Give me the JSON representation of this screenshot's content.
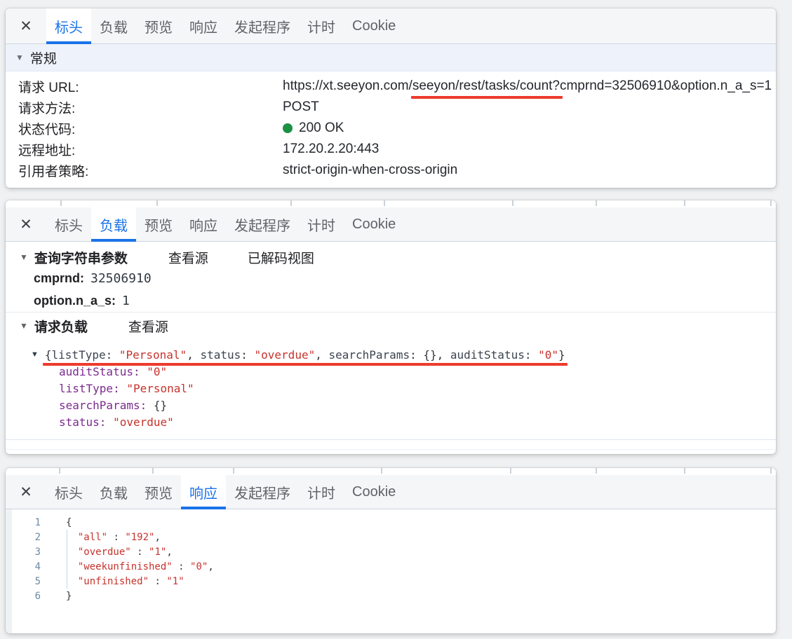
{
  "icons": {
    "close": "✕",
    "section_collapse": "▼",
    "tree_collapse": "▼"
  },
  "colors": {
    "accent_blue": "#1a73e8",
    "status_green": "#1c9144",
    "annotation_red": "#ee3a2c",
    "json_key_purple": "#7c2a8e",
    "json_string_red": "#c7322c"
  },
  "tab_labels": [
    "标头",
    "负载",
    "预览",
    "响应",
    "发起程序",
    "计时",
    "Cookie"
  ],
  "headers_panel": {
    "active_tab": "标头",
    "general_section_label": "常规",
    "rows": {
      "url": {
        "label": "请求 URL:",
        "prefix": "https://xt.seeyon.com/",
        "underlined": "seeyon/rest/tasks/count?",
        "suffix": "cmprnd=32506910&option.n_a_s=1"
      },
      "method": {
        "label": "请求方法:",
        "value": "POST"
      },
      "status": {
        "label": "状态代码:",
        "value": "200 OK"
      },
      "remote": {
        "label": "远程地址:",
        "value": "172.20.2.20:443"
      },
      "referrer": {
        "label": "引用者策略:",
        "value": "strict-origin-when-cross-origin"
      }
    }
  },
  "payload_panel": {
    "active_tab": "负载",
    "query_section": {
      "title": "查询字符串参数",
      "view_source_label": "查看源",
      "decoded_view_label": "已解码视图",
      "params": [
        {
          "name": "cmprnd:",
          "value": "32506910"
        },
        {
          "name": "option.n_a_s:",
          "value": "1"
        }
      ]
    },
    "payload_section": {
      "title": "请求负载",
      "view_source_label": "查看源",
      "preview_tokens": [
        {
          "t": "{",
          "c": "pun"
        },
        {
          "t": "listType",
          "c": "pkey"
        },
        {
          "t": ": ",
          "c": "pun"
        },
        {
          "t": "\"Personal\"",
          "c": "str"
        },
        {
          "t": ", ",
          "c": "pun"
        },
        {
          "t": "status",
          "c": "pkey"
        },
        {
          "t": ": ",
          "c": "pun"
        },
        {
          "t": "\"overdue\"",
          "c": "str"
        },
        {
          "t": ", ",
          "c": "pun"
        },
        {
          "t": "searchParams",
          "c": "pkey"
        },
        {
          "t": ": ",
          "c": "pun"
        },
        {
          "t": "{}",
          "c": "pun"
        },
        {
          "t": ", ",
          "c": "pun"
        },
        {
          "t": "auditStatus",
          "c": "pkey"
        },
        {
          "t": ": ",
          "c": "pun"
        },
        {
          "t": "\"0\"",
          "c": "str"
        },
        {
          "t": "}",
          "c": "pun"
        }
      ],
      "items": [
        {
          "key": "auditStatus:",
          "value": "\"0\""
        },
        {
          "key": "listType:",
          "value": "\"Personal\""
        },
        {
          "key": "searchParams:",
          "value": "{}"
        },
        {
          "key": "status:",
          "value": "\"overdue\""
        }
      ]
    }
  },
  "response_panel": {
    "active_tab": "响应",
    "lines": [
      {
        "num": "1",
        "tokens": [
          {
            "t": "{",
            "c": "pun"
          }
        ]
      },
      {
        "num": "2",
        "tokens": [
          {
            "t": "  \"all\"",
            "c": "str"
          },
          {
            "t": " : ",
            "c": "pun"
          },
          {
            "t": "\"192\"",
            "c": "str"
          },
          {
            "t": ",",
            "c": "pun"
          }
        ]
      },
      {
        "num": "3",
        "tokens": [
          {
            "t": "  \"overdue\"",
            "c": "str"
          },
          {
            "t": " : ",
            "c": "pun"
          },
          {
            "t": "\"1\"",
            "c": "str"
          },
          {
            "t": ",",
            "c": "pun"
          }
        ]
      },
      {
        "num": "4",
        "tokens": [
          {
            "t": "  \"weekunfinished\"",
            "c": "str"
          },
          {
            "t": " : ",
            "c": "pun"
          },
          {
            "t": "\"0\"",
            "c": "str"
          },
          {
            "t": ",",
            "c": "pun"
          }
        ]
      },
      {
        "num": "5",
        "tokens": [
          {
            "t": "  \"unfinished\"",
            "c": "str"
          },
          {
            "t": " : ",
            "c": "pun"
          },
          {
            "t": "\"1\"",
            "c": "str"
          }
        ]
      },
      {
        "num": "6",
        "tokens": [
          {
            "t": "}",
            "c": "pun"
          }
        ]
      }
    ]
  }
}
